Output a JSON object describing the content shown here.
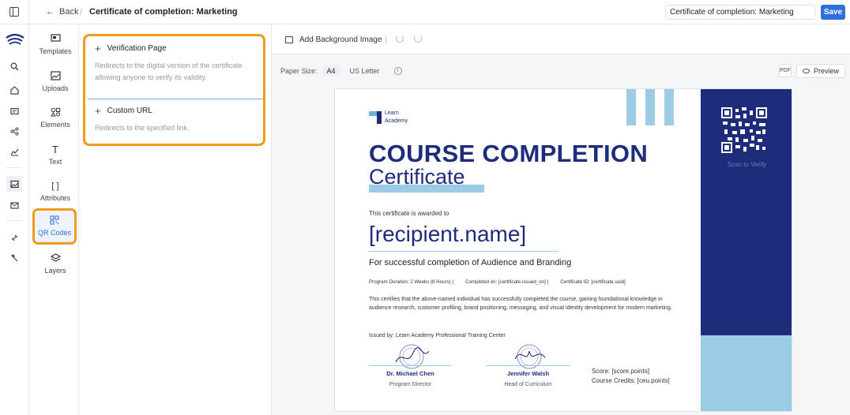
{
  "header": {
    "back_label": "Back",
    "separator": "/",
    "title": "Certificate of completion: Marketing",
    "title_input_value": "Certificate of completion: Marketing",
    "save_label": "Save"
  },
  "rail": {
    "icons": [
      "panel-toggle-icon",
      "search-icon",
      "home-icon",
      "courses-icon",
      "network-icon",
      "analytics-icon",
      "image-icon",
      "mail-icon",
      "integrations-icon",
      "tools-icon"
    ]
  },
  "tools": {
    "items": [
      {
        "label": "Templates",
        "icon": "templates-icon"
      },
      {
        "label": "Uploads",
        "icon": "uploads-icon"
      },
      {
        "label": "Elements",
        "icon": "elements-icon"
      },
      {
        "label": "Text",
        "icon": "text-icon"
      },
      {
        "label": "Attributes",
        "icon": "attributes-icon"
      },
      {
        "label": "QR Codes",
        "icon": "qr-code-icon",
        "active": true
      },
      {
        "label": "Layers",
        "icon": "layers-icon"
      }
    ]
  },
  "options": {
    "cards": [
      {
        "title": "Verification Page",
        "description": "Redirects to the digital version of the certificate allowing anyone to verify its validity."
      },
      {
        "title": "Custom URL",
        "description": "Redirects to the specified link."
      }
    ]
  },
  "canvas": {
    "add_background_label": "Add Background Image",
    "paper_size_label": "Paper Size:",
    "paper_options": [
      "A4",
      "US Letter"
    ],
    "paper_selected": "A4",
    "preview_label": "Preview"
  },
  "certificate": {
    "logo_text_line1": "Learn",
    "logo_text_line2": "Academy",
    "title": "COURSE COMPLETION",
    "subtitle": "Certificate",
    "awarded_text": "This certificate is awarded to",
    "recipient": "[recipient.name]",
    "success_line": "For successful completion of Audience and Branding",
    "meta_duration": "Program Duration: 2 Weeks (8 Hours) |",
    "meta_completed": "Completed on: [certificate.issued_on] |",
    "meta_id": "Certificate ID: [certificate.uuid]",
    "body": "This certifies that the above-named individual has successfully completed the course, gaining foundational knowledge in audience research, customer profiling, brand positioning, messaging, and visual identity development for modern marketing.",
    "issued_by": "Issued by: Learn Academy Professional Training Center",
    "signatures": [
      {
        "name": "Dr. Michael Chen",
        "role": "Program Director"
      },
      {
        "name": "Jennifer Walsh",
        "role": "Head of Curriculum"
      }
    ],
    "score_line": "Score: [score.points]",
    "credits_line": "Course Credits: [ceu.points]",
    "scan_text": "Scan to Verify",
    "colors": {
      "navy": "#1e2c7c",
      "light_blue": "#9ccbe6"
    }
  }
}
